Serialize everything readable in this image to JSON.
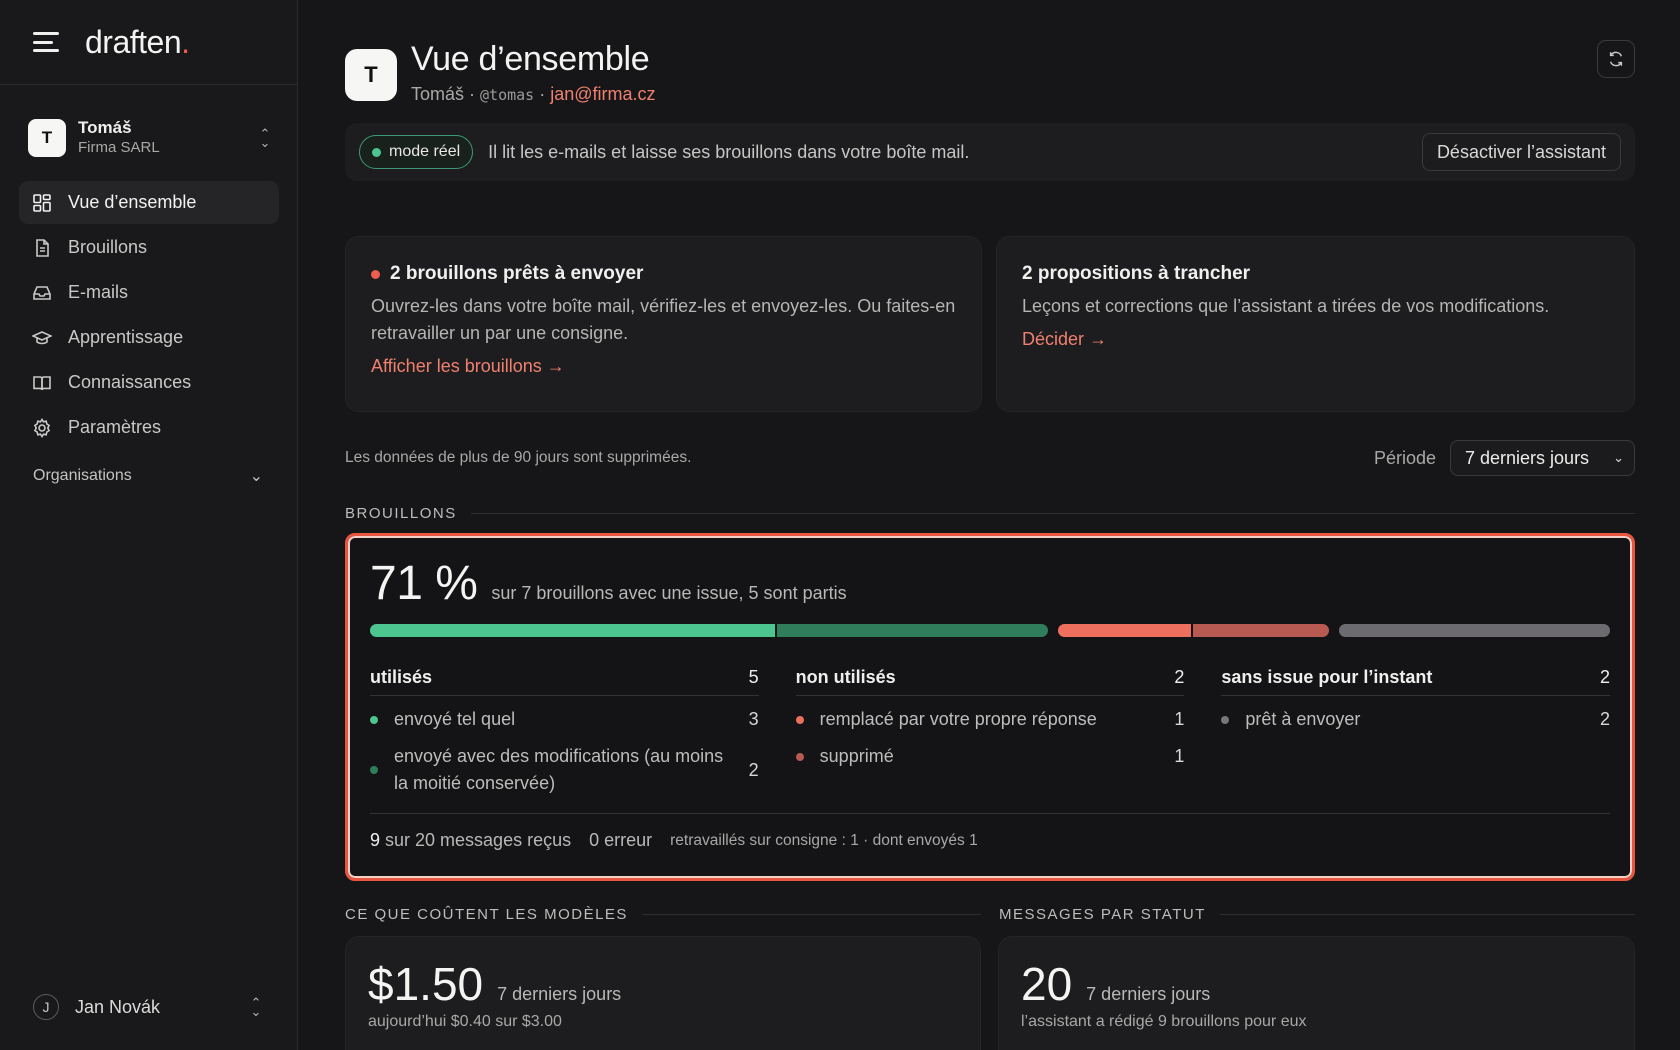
{
  "brand": {
    "logo": "draften",
    "logo_dot": "."
  },
  "account": {
    "initial": "T",
    "name": "Tomáš",
    "org": "Firma SARL"
  },
  "nav": [
    {
      "label": "Vue d’ensemble",
      "icon": "dashboard-icon",
      "active": true
    },
    {
      "label": "Brouillons",
      "icon": "document-icon",
      "active": false
    },
    {
      "label": "E-mails",
      "icon": "inbox-icon",
      "active": false
    },
    {
      "label": "Apprentissage",
      "icon": "graduation-cap-icon",
      "active": false
    },
    {
      "label": "Connaissances",
      "icon": "book-icon",
      "active": false
    },
    {
      "label": "Paramètres",
      "icon": "gear-icon",
      "active": false
    }
  ],
  "organisations_label": "Organisations",
  "user": {
    "initial": "J",
    "name": "Jan Novák"
  },
  "page": {
    "initial": "T",
    "title": "Vue d’ensemble",
    "name": "Tomáš",
    "sep": " · ",
    "handle": "@tomas",
    "email": "jan@firma.cz"
  },
  "banner": {
    "mode": "mode réel",
    "text": "Il lit les e-mails et laisse ses brouillons dans votre boîte mail.",
    "button": "Désactiver l’assistant"
  },
  "ready_card": {
    "title": "2 brouillons prêts à envoyer",
    "text": "Ouvrez-les dans votre boîte mail, vérifiez-les et envoyez-les. Ou faites-en retravailler un par une consigne.",
    "link": "Afficher les brouillons →"
  },
  "props_card": {
    "title": "2 propositions à trancher",
    "text": "Leçons et corrections que l’assistant a tirées de vos modifications.",
    "link": "Décider →"
  },
  "period": {
    "note": "Les données de plus de 90 jours sont supprimées.",
    "label": "Période",
    "selected": "7 derniers jours"
  },
  "drafts": {
    "section": "BROUILLONS",
    "pct": "71 %",
    "summary": "sur 7 brouillons avec une issue, 5 sont partis",
    "columns": [
      {
        "title": "utilisés",
        "count": "5",
        "rows": [
          {
            "label": "envoyé tel quel",
            "count": "3",
            "color": "#4cc58f"
          },
          {
            "label": "envoyé avec des modifications (au moins la moitié conservée)",
            "count": "2",
            "color": "#2f7d5b"
          }
        ]
      },
      {
        "title": "non utilisés",
        "count": "2",
        "rows": [
          {
            "label": "remplacé par votre propre réponse",
            "count": "1",
            "color": "#ef6f5f"
          },
          {
            "label": "supprimé",
            "count": "1",
            "color": "#b85a52"
          }
        ]
      },
      {
        "title": "sans issue pour l’instant",
        "count": "2",
        "rows": [
          {
            "label": "prêt à envoyer",
            "count": "2",
            "color": "#77777a"
          }
        ]
      }
    ],
    "bar_segments": [
      {
        "name": "sent-as-is",
        "value": 3,
        "color": "#4cc58f"
      },
      {
        "name": "sent-modified",
        "value": 2,
        "color": "#2f7d5b"
      },
      {
        "name": "replaced",
        "value": 1,
        "color": "#ef6f5f"
      },
      {
        "name": "deleted",
        "value": 1,
        "color": "#b85a52"
      },
      {
        "name": "pending",
        "value": 2,
        "color": "#6c6c70"
      }
    ],
    "foot": {
      "received_count": "9",
      "received_text": " sur 20 messages reçus",
      "errors": "0 erreur",
      "rework": "retravaillés sur consigne : 1 · dont envoyés 1"
    }
  },
  "costs": {
    "section": "CE QUE COÛTENT LES MODÈLES",
    "value": "$1.50",
    "period": "7 derniers jours",
    "sub": "aujourd’hui $0.40 sur $3.00"
  },
  "messages": {
    "section": "MESSAGES PAR STATUT",
    "value": "20",
    "period": "7 derniers jours",
    "sub": "l’assistant a rédigé 9 brouillons pour eux"
  }
}
